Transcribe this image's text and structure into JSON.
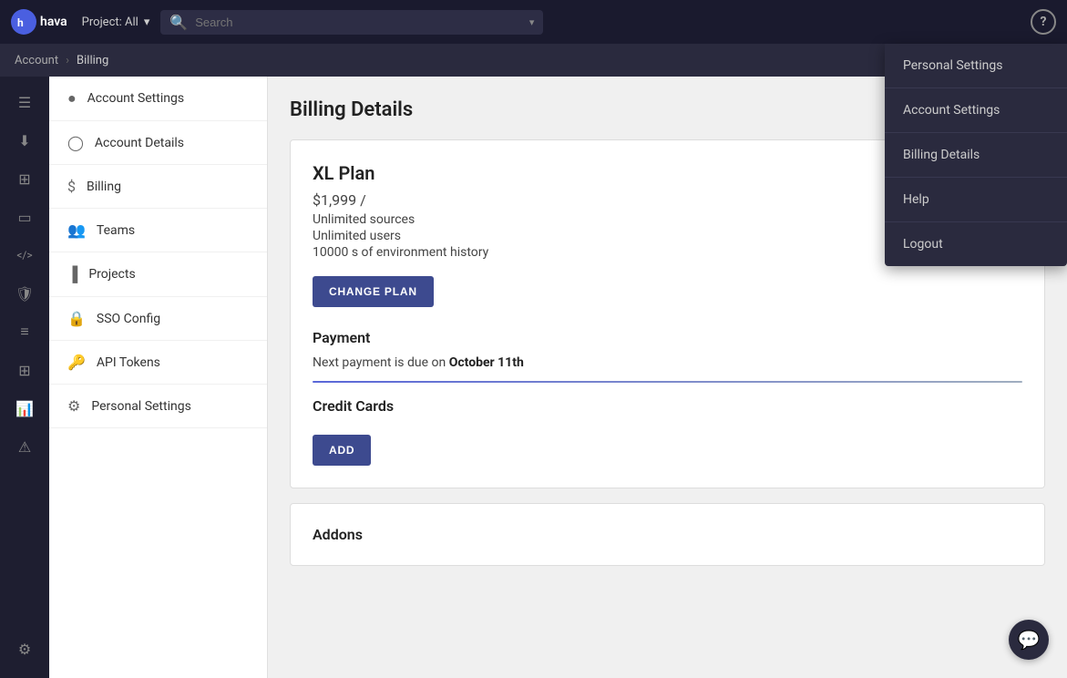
{
  "topnav": {
    "logo_text": "hava",
    "project_label": "Project: All",
    "search_placeholder": "Search",
    "help_label": "?"
  },
  "breadcrumb": {
    "items": [
      "Account",
      "Billing"
    ],
    "separator": "›"
  },
  "icon_sidebar": {
    "items": [
      {
        "name": "menu-icon",
        "symbol": "☰"
      },
      {
        "name": "download-icon",
        "symbol": "⬇"
      },
      {
        "name": "grid-icon",
        "symbol": "⊞"
      },
      {
        "name": "monitor-icon",
        "symbol": "🖥"
      },
      {
        "name": "code-icon",
        "symbol": "<>"
      },
      {
        "name": "shield-icon",
        "symbol": "🛡"
      },
      {
        "name": "list-icon",
        "symbol": "≡"
      },
      {
        "name": "table-icon",
        "symbol": "⊞"
      },
      {
        "name": "chart-icon",
        "symbol": "📊"
      },
      {
        "name": "alert-icon",
        "symbol": "⚠"
      }
    ],
    "bottom_item": {
      "name": "settings-icon",
      "symbol": "⚙"
    }
  },
  "left_nav": {
    "items": [
      {
        "label": "Account Settings",
        "icon": "person-circle"
      },
      {
        "label": "Account Details",
        "icon": "person"
      },
      {
        "label": "Billing",
        "icon": "dollar"
      },
      {
        "label": "Teams",
        "icon": "people"
      },
      {
        "label": "Projects",
        "icon": "bar-chart"
      },
      {
        "label": "SSO Config",
        "icon": "lock"
      },
      {
        "label": "API Tokens",
        "icon": "key"
      },
      {
        "label": "Personal Settings",
        "icon": "gear"
      }
    ]
  },
  "main": {
    "page_title": "Billing Details",
    "plan_section": {
      "plan_name": "XL Plan",
      "price": "$1,999 /",
      "features": [
        "Unlimited sources",
        "Unlimited users",
        "10000 s of environment history"
      ],
      "change_plan_btn": "CHANGE PLAN"
    },
    "payment_section": {
      "title": "Payment",
      "text_prefix": "Next payment is due on ",
      "due_date": "October 11th"
    },
    "credit_cards_section": {
      "title": "Credit Cards",
      "add_btn": "ADD"
    },
    "addons_section": {
      "title": "Addons"
    }
  },
  "dropdown_menu": {
    "items": [
      {
        "label": "Personal Settings"
      },
      {
        "label": "Account Settings"
      },
      {
        "label": "Billing Details"
      },
      {
        "label": "Help"
      },
      {
        "label": "Logout"
      }
    ]
  },
  "chat_btn": {
    "symbol": "💬"
  }
}
